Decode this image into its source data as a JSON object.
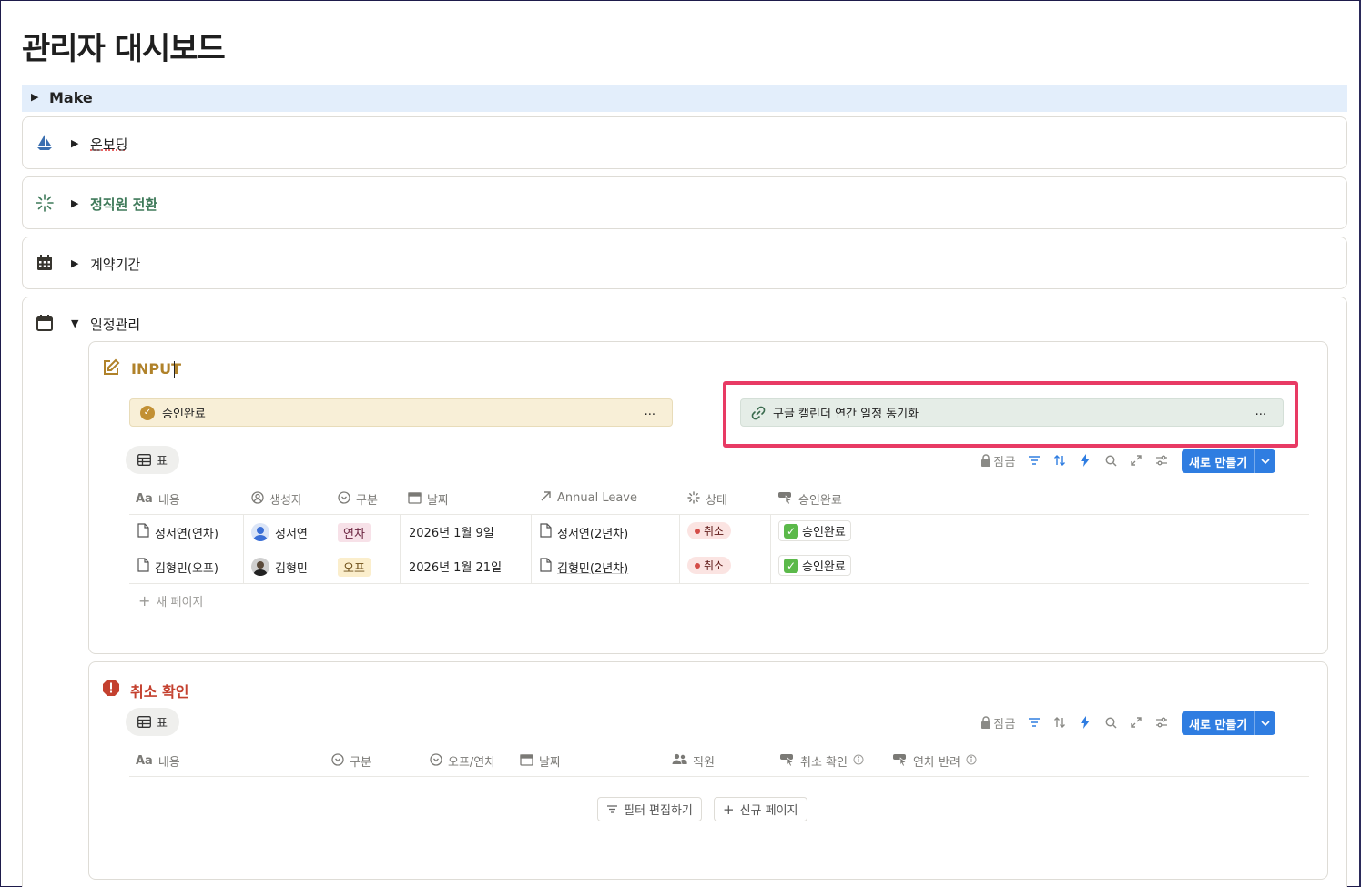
{
  "page": {
    "title": "관리자 대시보드"
  },
  "make": {
    "label": "Make"
  },
  "sections": [
    {
      "label": "온보딩",
      "icon": "sailboat-icon"
    },
    {
      "label": "정직원 전환",
      "icon": "sparkle-icon"
    },
    {
      "label": "계약기간",
      "icon": "calendar-grid-icon"
    },
    {
      "label": "일정관리",
      "icon": "calendar-icon"
    }
  ],
  "input_section": {
    "title": "INPUT",
    "buttons": [
      {
        "label": "승인완료",
        "more": "..."
      },
      {
        "label": "구글 캘린더 연간 일정 동기화",
        "more": "..."
      }
    ],
    "view_tab": "표",
    "toolbar": {
      "lock_label": "잠금",
      "new_label": "새로 만들기"
    },
    "columns": [
      "내용",
      "생성자",
      "구분",
      "날짜",
      "Annual Leave",
      "상태",
      "승인완료"
    ],
    "rows": [
      {
        "content": "정서연(연차)",
        "creator": "정서연",
        "type": "연차",
        "date": "2026년 1월 9일",
        "annual_leave": "정서연(2년차)",
        "status": "취소",
        "approval": "승인완료"
      },
      {
        "content": "김형민(오프)",
        "creator": "김형민",
        "type": "오프",
        "date": "2026년 1월 21일",
        "annual_leave": "김형민(2년차)",
        "status": "취소",
        "approval": "승인완료"
      }
    ],
    "new_page": "새 페이지"
  },
  "cancel_section": {
    "title": "취소 확인",
    "view_tab": "표",
    "toolbar": {
      "lock_label": "잠금",
      "new_label": "새로 만들기"
    },
    "columns": [
      "내용",
      "구분",
      "오프/연차",
      "날짜",
      "직원",
      "취소 확인",
      "연차 반려"
    ],
    "empty_actions": {
      "edit_filter": "필터 편집하기",
      "new_page": "신규 페이지"
    }
  },
  "colors": {
    "accent": "#2f7de1",
    "highlight": "#e83a64",
    "input_title": "#b0822a",
    "cancel_title": "#c4412f",
    "green_section": "#3f7a5a"
  }
}
